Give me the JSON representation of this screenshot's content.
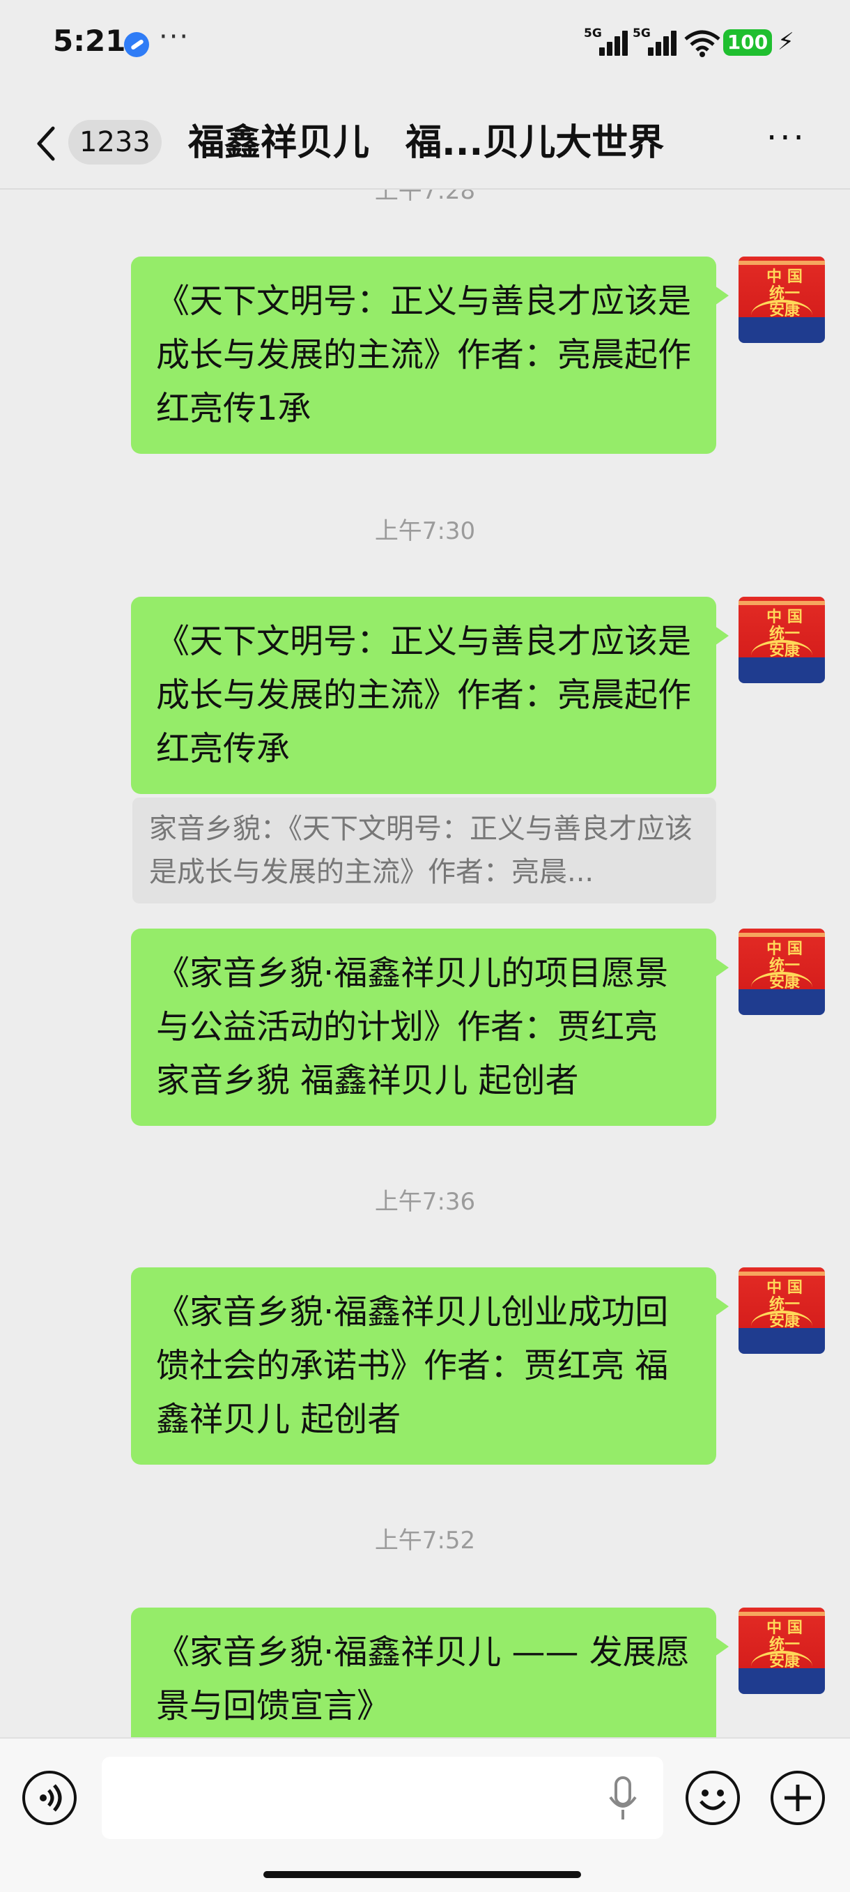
{
  "status_bar": {
    "time": "5:21",
    "more": "···",
    "signal1_label": "5G",
    "signal2_label": "5G",
    "battery": "100"
  },
  "header": {
    "unread_count": "1233",
    "title": "福鑫祥贝儿　福...贝儿大世界",
    "more": "···"
  },
  "messages": [
    {
      "type": "timestamp",
      "text": "上午7:28"
    },
    {
      "type": "text",
      "text": "《天下文明号：正义与善良才应该是成长与发展的主流》作者：亮晨起作 红亮传1承"
    },
    {
      "type": "timestamp",
      "text": "上午7:30"
    },
    {
      "type": "text",
      "text": "《天下文明号：正义与善良才应该是成长与发展的主流》作者：亮晨起作 红亮传承"
    },
    {
      "type": "quote",
      "text": "家音乡貌：《天下文明号：正义与善良才应该是成长与发展的主流》作者：亮晨..."
    },
    {
      "type": "text",
      "text": "《家音乡貌·福鑫祥贝儿的项目愿景与公益活动的计划》作者：贾红亮 家音乡貌 福鑫祥贝儿 起创者"
    },
    {
      "type": "timestamp",
      "text": "上午7:36"
    },
    {
      "type": "text",
      "text": "《家音乡貌·福鑫祥贝儿创业成功回馈社会的承诺书》作者：贾红亮 福鑫祥贝儿 起创者"
    },
    {
      "type": "timestamp",
      "text": "上午7:52"
    },
    {
      "type": "text",
      "text": "《家音乡貌·福鑫祥贝儿 —— 发展愿景与回馈宣言》"
    }
  ],
  "avatar": {
    "label": "中 国 统一安康",
    "icon": "red-banner-avatar"
  },
  "input_bar": {
    "placeholder": "",
    "icons": [
      "voice-icon",
      "mic-icon",
      "emoji-icon",
      "plus-icon"
    ]
  },
  "colors": {
    "bubble": "#95ec69",
    "background": "#ededed",
    "battery": "#1fbf2f"
  }
}
